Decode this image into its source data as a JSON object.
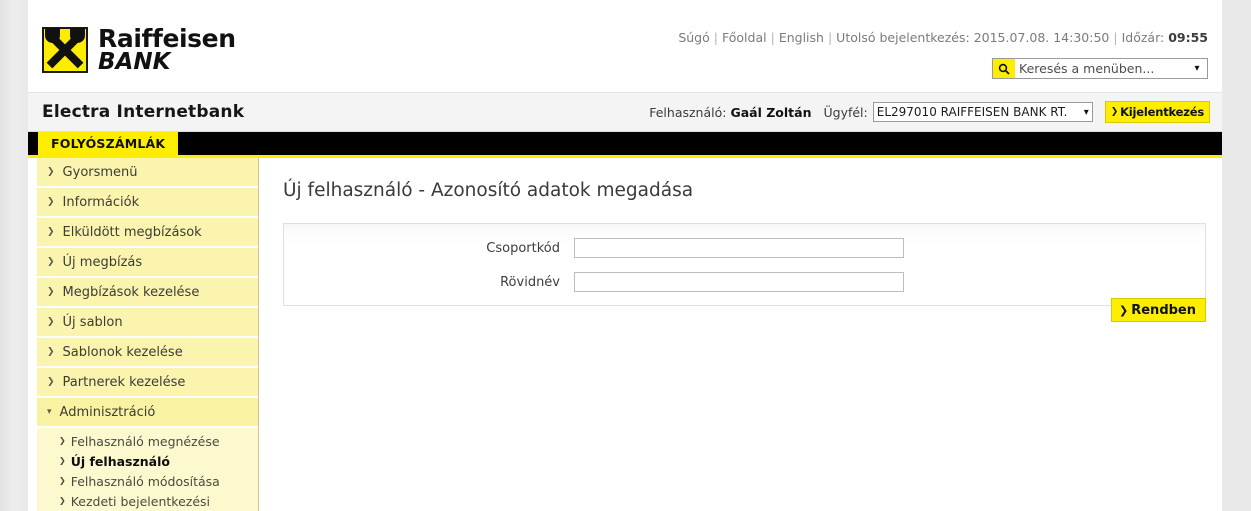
{
  "brand": {
    "name_line1": "Raiffeisen",
    "name_line2": "BANK",
    "logo_icon": "raiffeisen-crossed-horseheads-logo"
  },
  "header": {
    "links": [
      {
        "label": "Súgó"
      },
      {
        "label": "Főoldal"
      },
      {
        "label": "English"
      }
    ],
    "separator": "|",
    "last_login_label": "Utolsó bejelentkezés:",
    "last_login_value": "2015.07.08. 14:30:50",
    "timer_label": "Időzár:",
    "timer_value": "09:55",
    "search": {
      "icon": "search-icon",
      "placeholder": "Keresés a menüben...",
      "value": "",
      "caret_icon": "chevron-down-icon"
    }
  },
  "appbar": {
    "title": "Electra Internetbank",
    "user_label": "Felhasználó:",
    "user_name": "Gaál Zoltán",
    "client_label": "Ügyfél:",
    "client_value": "EL297010 RAIFFEISEN BANK RT.",
    "client_caret_icon": "chevron-down-icon",
    "logout_label": "Kijelentkezés",
    "logout_chevron": "❯"
  },
  "navstrip": {
    "active_tab": "FOLYÓSZÁMLÁK"
  },
  "sidebar": {
    "items": [
      {
        "label": "Gyorsmenü",
        "arrow": "❯",
        "expanded": false
      },
      {
        "label": "Információk",
        "arrow": "❯",
        "expanded": false
      },
      {
        "label": "Elküldött megbízások",
        "arrow": "❯",
        "expanded": false
      },
      {
        "label": "Új megbízás",
        "arrow": "❯",
        "expanded": false
      },
      {
        "label": "Megbízások kezelése",
        "arrow": "❯",
        "expanded": false
      },
      {
        "label": "Új sablon",
        "arrow": "❯",
        "expanded": false
      },
      {
        "label": "Sablonok kezelése",
        "arrow": "❯",
        "expanded": false
      },
      {
        "label": "Partnerek kezelése",
        "arrow": "❯",
        "expanded": false
      },
      {
        "label": "Adminisztráció",
        "arrow": "❮",
        "expanded": true
      }
    ],
    "submenu": [
      {
        "label": "Felhasználó megnézése",
        "arrow": "❯",
        "active": false
      },
      {
        "label": "Új felhasználó",
        "arrow": "❯",
        "active": true
      },
      {
        "label": "Felhasználó módosítása",
        "arrow": "❯",
        "active": false
      },
      {
        "label": "Kezdeti bejelentkezési",
        "arrow": "❯",
        "active": false
      }
    ]
  },
  "main": {
    "page_title": "Új felhasználó - Azonosító adatok megadása",
    "fields": [
      {
        "label": "Csoportkód",
        "value": "",
        "placeholder": ""
      },
      {
        "label": "Rövidnév",
        "value": "",
        "placeholder": ""
      }
    ],
    "submit_label": "Rendben",
    "submit_chevron": "❯"
  },
  "colors": {
    "brand_yellow": "#ffed00",
    "menu_yellow": "#faf4ae",
    "submenu_yellow": "#fdf9cf",
    "nav_black": "#000000",
    "page_gray": "#e9e9e9"
  }
}
